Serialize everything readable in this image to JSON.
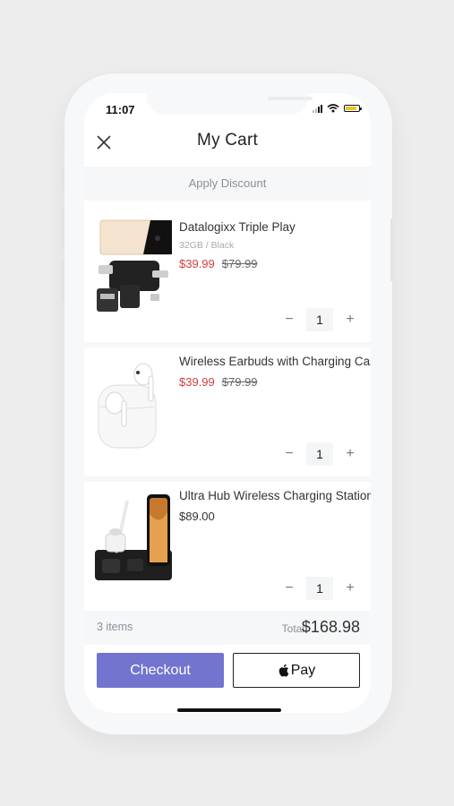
{
  "status": {
    "time": "11:07"
  },
  "header": {
    "title": "My Cart"
  },
  "discount": {
    "label": "Apply Discount"
  },
  "items": [
    {
      "name": "Datalogixx Triple Play",
      "variant": "32GB / Black",
      "price": "$39.99",
      "old_price": "$79.99",
      "qty": "1"
    },
    {
      "name": "Wireless Earbuds with Charging Case",
      "price": "$39.99",
      "old_price": "$79.99",
      "qty": "1"
    },
    {
      "name": "Ultra Hub Wireless Charging Station",
      "price": "$89.00",
      "qty": "1"
    }
  ],
  "summary": {
    "count": "3 items",
    "total_label": "Total",
    "total": "$168.98"
  },
  "actions": {
    "checkout": "Checkout",
    "applepay": "Pay"
  },
  "colors": {
    "accent": "#7274cf",
    "sale": "#d23d3d"
  }
}
